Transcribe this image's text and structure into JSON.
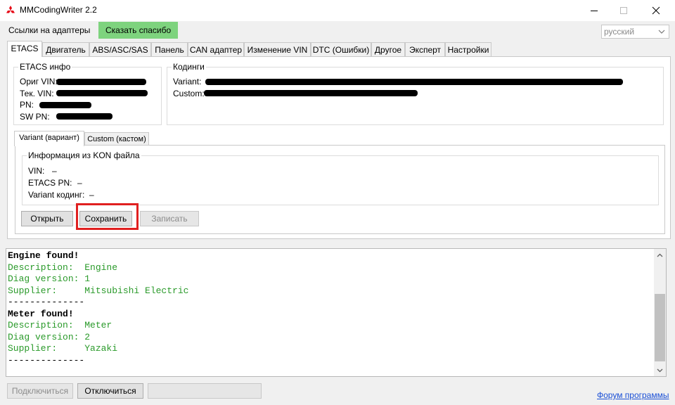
{
  "window": {
    "title": "MMCodingWriter 2.2",
    "minimize": "—",
    "maximize": "☐",
    "close": "✕"
  },
  "topbar": {
    "adapters_link": "Ссылки на адаптеры",
    "thanks_button": "Сказать спасибо",
    "language": "русский"
  },
  "tabs": [
    "ETACS",
    "Двигатель",
    "ABS/ASC/SAS",
    "Панель",
    "CAN адаптер",
    "Изменение VIN",
    "DTC (Ошибки)",
    "Другое",
    "Эксперт",
    "Настройки"
  ],
  "etacs_info": {
    "title": "ETACS инфо",
    "orig_vin_label": "Ориг VIN:",
    "cur_vin_label": "Тек. VIN:",
    "pn_label": "PN:",
    "sw_pn_label": "SW PN:"
  },
  "codings": {
    "title": "Кодинги",
    "variant_label": "Variant:",
    "custom_label": "Custom:"
  },
  "subtabs": [
    "Variant (вариант)",
    "Custom (кастом)"
  ],
  "kon_info": {
    "title": "Информация из KON файла",
    "vin_label": "VIN:",
    "vin_value": "–",
    "etacs_pn_label": "ETACS PN:",
    "etacs_pn_value": "–",
    "variant_coding_label": "Variant кодинг:",
    "variant_coding_value": "–"
  },
  "actions": {
    "open": "Открыть",
    "save": "Сохранить",
    "write": "Записать"
  },
  "console": [
    {
      "text": "Engine found!",
      "style": "dark"
    },
    {
      "text": "Description:  Engine",
      "style": "green"
    },
    {
      "text": "Diag version: 1",
      "style": "green"
    },
    {
      "text": "Supplier:     Mitsubishi Electric",
      "style": "green"
    },
    {
      "text": "--------------",
      "style": "sep"
    },
    {
      "text": "Meter found!",
      "style": "dark"
    },
    {
      "text": "Description:  Meter",
      "style": "green"
    },
    {
      "text": "Diag version: 2",
      "style": "green"
    },
    {
      "text": "Supplier:     Yazaki",
      "style": "green"
    },
    {
      "text": "--------------",
      "style": "sep"
    }
  ],
  "bottom": {
    "connect": "Подключиться",
    "disconnect": "Отключиться",
    "forum_link": "Форум программы"
  },
  "colors": {
    "thanks_bg": "#7ed37e",
    "console_green": "#2a9a2a",
    "highlight": "#e02020",
    "link": "#1a4fd6"
  }
}
